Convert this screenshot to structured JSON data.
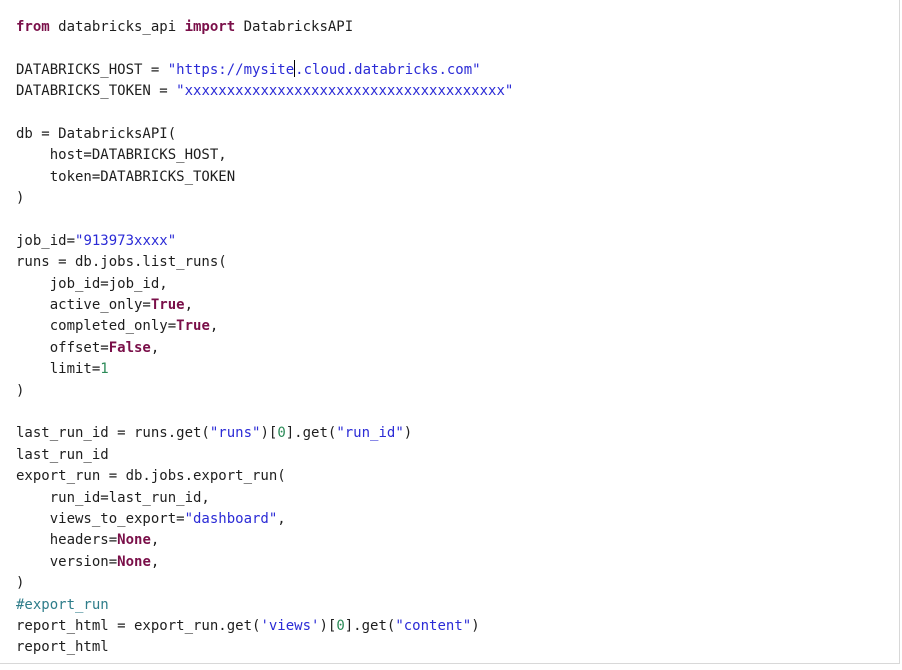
{
  "colors": {
    "keyword": "#7a0f49",
    "string": "#2b2bd6",
    "number": "#2b8a57",
    "comment": "#2e7d8a",
    "text": "#1e1e1e",
    "background": "#ffffff"
  },
  "code": {
    "l1": {
      "t1": "from",
      "t2": " databricks_api ",
      "t3": "import",
      "t4": " DatabricksAPI"
    },
    "l3": {
      "t1": "DATABRICKS_HOST = ",
      "t2": "\"https://mysite",
      "t3": ".cloud.databricks.com\""
    },
    "l4": {
      "t1": "DATABRICKS_TOKEN = ",
      "t2": "\"xxxxxxxxxxxxxxxxxxxxxxxxxxxxxxxxxxxxxx\""
    },
    "l6": {
      "t1": "db = DatabricksAPI("
    },
    "l7": {
      "t1": "    host=DATABRICKS_HOST,"
    },
    "l8": {
      "t1": "    token=DATABRICKS_TOKEN"
    },
    "l9": {
      "t1": ")"
    },
    "l11": {
      "t1": "job_id=",
      "t2": "\"913973xxxx\""
    },
    "l12": {
      "t1": "runs = db.jobs.list_runs("
    },
    "l13": {
      "t1": "    job_id=job_id,"
    },
    "l14": {
      "t1": "    active_only=",
      "t2": "True",
      "t3": ","
    },
    "l15": {
      "t1": "    completed_only=",
      "t2": "True",
      "t3": ","
    },
    "l16": {
      "t1": "    offset=",
      "t2": "False",
      "t3": ","
    },
    "l17": {
      "t1": "    limit=",
      "t2": "1"
    },
    "l18": {
      "t1": ")"
    },
    "l20": {
      "t1": "last_run_id = runs.get(",
      "t2": "\"runs\"",
      "t3": ")[",
      "t4": "0",
      "t5": "].get(",
      "t6": "\"run_id\"",
      "t7": ")"
    },
    "l21": {
      "t1": "last_run_id"
    },
    "l22": {
      "t1": "export_run = db.jobs.export_run("
    },
    "l23": {
      "t1": "    run_id=last_run_id,"
    },
    "l24": {
      "t1": "    views_to_export=",
      "t2": "\"dashboard\"",
      "t3": ","
    },
    "l25": {
      "t1": "    headers=",
      "t2": "None",
      "t3": ","
    },
    "l26": {
      "t1": "    version=",
      "t2": "None",
      "t3": ","
    },
    "l27": {
      "t1": ")"
    },
    "l28": {
      "t1": "#export_run"
    },
    "l29": {
      "t1": "report_html = export_run.get(",
      "t2": "'views'",
      "t3": ")[",
      "t4": "0",
      "t5": "].get(",
      "t6": "\"content\"",
      "t7": ")"
    },
    "l30": {
      "t1": "report_html"
    }
  }
}
